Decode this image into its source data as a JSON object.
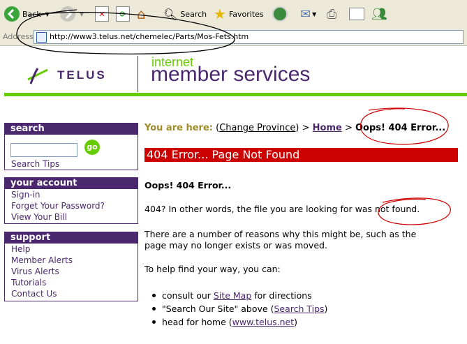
{
  "toolbar": {
    "back_label": "Back",
    "search_label": "Search",
    "favorites_label": "Favorites"
  },
  "address": {
    "label": "Address",
    "url": "http://www3.telus.net/chemelec/Parts/Mos-Fets.htm"
  },
  "header": {
    "logo_text": "TELUS",
    "internet": "internet",
    "member_services": "member services"
  },
  "sidebar": {
    "search": {
      "title": "search",
      "go_label": "go",
      "tips": "Search Tips",
      "input_value": ""
    },
    "account": {
      "title": "your account",
      "links": [
        "Sign-in",
        "Forget Your Password?",
        "View Your Bill"
      ]
    },
    "support": {
      "title": "support",
      "links": [
        "Help",
        "Member Alerts",
        "Virus Alerts",
        "Tutorials",
        "Contact Us"
      ]
    }
  },
  "breadcrumb": {
    "prefix": "You are here:",
    "change_province": "Change Province",
    "home": "Home",
    "current": "Oops! 404 Error..."
  },
  "main": {
    "banner": "404 Error... Page Not Found",
    "heading": "Oops! 404 Error...",
    "p1": "404? In other words, the file you are looking for was not found.",
    "p2a": "There are a number of reasons why this might be, such as the",
    "p2b": "page may no longer exists or was moved.",
    "p3": "To help find your way, you can:",
    "b1_pre": "consult our ",
    "b1_link": "Site Map",
    "b1_post": " for directions",
    "b2_pre": "\"Search Our Site\" above (",
    "b2_link": "Search Tips",
    "b2_post": ")",
    "b3_pre": "head for home (",
    "b3_link": "www.telus.net",
    "b3_post": ")"
  },
  "colors": {
    "purple": "#4b286d",
    "green": "#66cc00",
    "red": "#cc0000",
    "gold": "#a08b2a"
  }
}
